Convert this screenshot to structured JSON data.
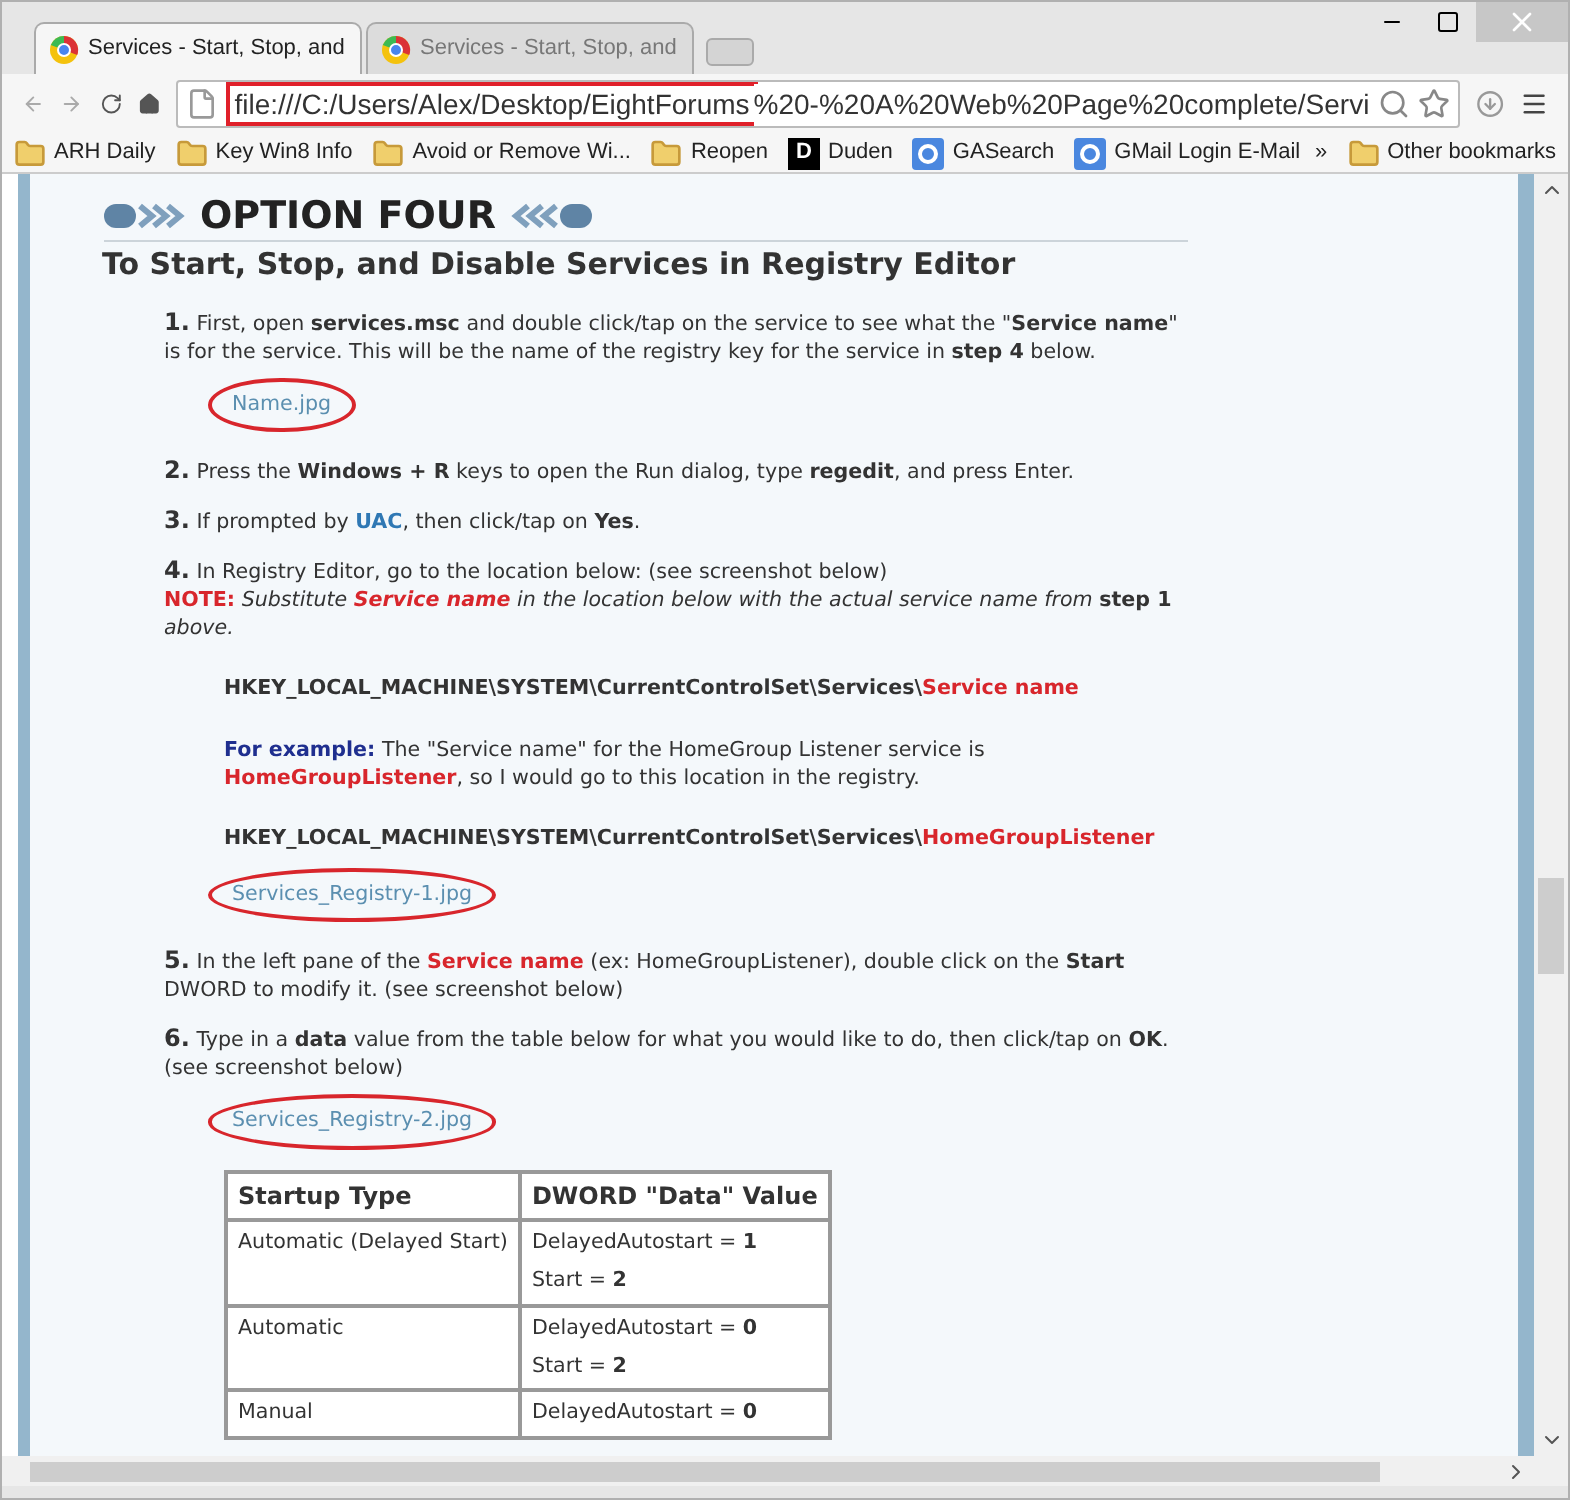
{
  "tabs": [
    {
      "title": "Services - Start, Stop, and",
      "selected": true
    },
    {
      "title": "Services - Start, Stop, and",
      "selected": false
    }
  ],
  "address": {
    "highlighted": "file:///C:/Users/Alex/Desktop/EightForums",
    "rest": "%20-%20A%20Web%20Page%20complete/Servi"
  },
  "bookmarks": [
    {
      "label": "ARH Daily",
      "kind": "folder"
    },
    {
      "label": "Key Win8 Info",
      "kind": "folder"
    },
    {
      "label": "Avoid or Remove Wi...",
      "kind": "folder"
    },
    {
      "label": "Reopen",
      "kind": "folder"
    },
    {
      "label": "Duden",
      "kind": "letter",
      "icon": "D"
    },
    {
      "label": "GASearch",
      "kind": "google"
    },
    {
      "label": "GMail Login E-Mail",
      "kind": "google"
    }
  ],
  "bookmarks_overflow": "»",
  "other_bookmarks": "Other bookmarks",
  "heading": "OPTION FOUR",
  "subheading": "To Start, Stop, and Disable Services in Registry Editor",
  "blocks": [
    {
      "kind": "step",
      "number": "1.",
      "segments": [
        {
          "t": "First, open ",
          "kind": "plain"
        },
        {
          "t": "services.msc",
          "kind": "bold"
        },
        {
          "t": " and double click/tap on the service to see what the \"",
          "kind": "plain"
        },
        {
          "t": "Service name",
          "kind": "bold"
        },
        {
          "t": "\" is for the service. This will be the name of the registry key for the service in ",
          "kind": "plain"
        },
        {
          "t": "step 4",
          "kind": "bold"
        },
        {
          "t": " below.",
          "kind": "plain"
        }
      ]
    },
    {
      "kind": "link",
      "text": "Name.jpg"
    },
    {
      "kind": "step",
      "number": "2.",
      "segments": [
        {
          "t": "Press the ",
          "kind": "plain"
        },
        {
          "t": "Windows + R",
          "kind": "bold"
        },
        {
          "t": " keys to open the Run dialog, type ",
          "kind": "plain"
        },
        {
          "t": "regedit",
          "kind": "bold"
        },
        {
          "t": ", and press Enter.",
          "kind": "plain"
        }
      ]
    },
    {
      "kind": "step",
      "number": "3.",
      "segments": [
        {
          "t": "If prompted by ",
          "kind": "plain"
        },
        {
          "t": "UAC",
          "kind": "link"
        },
        {
          "t": ", then click/tap on ",
          "kind": "plain"
        },
        {
          "t": "Yes",
          "kind": "bold"
        },
        {
          "t": ".",
          "kind": "plain"
        }
      ]
    },
    {
      "kind": "step",
      "number": "4.",
      "segments": [
        {
          "t": "In Registry Editor, go to the location below: (see screenshot below)",
          "kind": "plain"
        }
      ],
      "note": [
        {
          "t": "NOTE:",
          "kind": "red"
        },
        {
          "t": " Substitute ",
          "kind": "italic"
        },
        {
          "t": "Service name",
          "kind": "redit"
        },
        {
          "t": " in the location below with the actual service name from ",
          "kind": "italic"
        },
        {
          "t": "step 1",
          "kind": "bold"
        },
        {
          "t": " above.",
          "kind": "italic"
        }
      ]
    },
    {
      "kind": "path",
      "segments": [
        {
          "t": "HKEY_LOCAL_MACHINE\\SYSTEM\\CurrentControlSet\\Services\\",
          "kind": "bold"
        },
        {
          "t": "Service name",
          "kind": "red"
        }
      ]
    },
    {
      "kind": "example",
      "segments": [
        {
          "t": "For example:",
          "kind": "navy"
        },
        {
          "t": " The \"Service name\" for the HomeGroup Listener service is ",
          "kind": "plain"
        },
        {
          "t": "HomeGroupListener",
          "kind": "red"
        },
        {
          "t": ", so I would go to this location in the registry.",
          "kind": "plain"
        }
      ]
    },
    {
      "kind": "path",
      "segments": [
        {
          "t": "HKEY_LOCAL_MACHINE\\SYSTEM\\CurrentControlSet\\Services\\",
          "kind": "bold"
        },
        {
          "t": "HomeGroupListener",
          "kind": "red"
        }
      ]
    },
    {
      "kind": "link",
      "text": "Services_Registry-1.jpg"
    },
    {
      "kind": "step",
      "number": "5.",
      "segments": [
        {
          "t": "In the left pane of the ",
          "kind": "plain"
        },
        {
          "t": "Service name",
          "kind": "red"
        },
        {
          "t": " (ex: HomeGroupListener), double click on the ",
          "kind": "plain"
        },
        {
          "t": "Start",
          "kind": "bold"
        },
        {
          "t": " DWORD to modify it. (see screenshot below)",
          "kind": "plain"
        }
      ]
    },
    {
      "kind": "step",
      "number": "6.",
      "segments": [
        {
          "t": "Type in a ",
          "kind": "plain"
        },
        {
          "t": "data",
          "kind": "bold"
        },
        {
          "t": " value from the table below for what you would like to do, then click/tap on ",
          "kind": "plain"
        },
        {
          "t": "OK",
          "kind": "bold"
        },
        {
          "t": ". (see screenshot below)",
          "kind": "plain"
        }
      ]
    },
    {
      "kind": "link",
      "text": "Services_Registry-2.jpg"
    }
  ],
  "table": {
    "columns": [
      "Startup Type",
      "DWORD \"Data\" Value"
    ],
    "rows": [
      {
        "type": "Automatic (Delayed Start)",
        "values": [
          [
            {
              "t": "DelayedAutostart = ",
              "kind": "plain"
            },
            {
              "t": "1",
              "kind": "bold"
            }
          ],
          [
            {
              "t": "Start = ",
              "kind": "plain"
            },
            {
              "t": "2",
              "kind": "bold"
            }
          ]
        ]
      },
      {
        "type": "Automatic",
        "values": [
          [
            {
              "t": "DelayedAutostart = ",
              "kind": "plain"
            },
            {
              "t": "0",
              "kind": "bold"
            }
          ],
          [
            {
              "t": "Start = ",
              "kind": "plain"
            },
            {
              "t": "2",
              "kind": "bold"
            }
          ]
        ]
      },
      {
        "type": "Manual",
        "values": [
          [
            {
              "t": "DelayedAutostart = ",
              "kind": "plain"
            },
            {
              "t": "0",
              "kind": "bold"
            }
          ]
        ]
      }
    ]
  }
}
